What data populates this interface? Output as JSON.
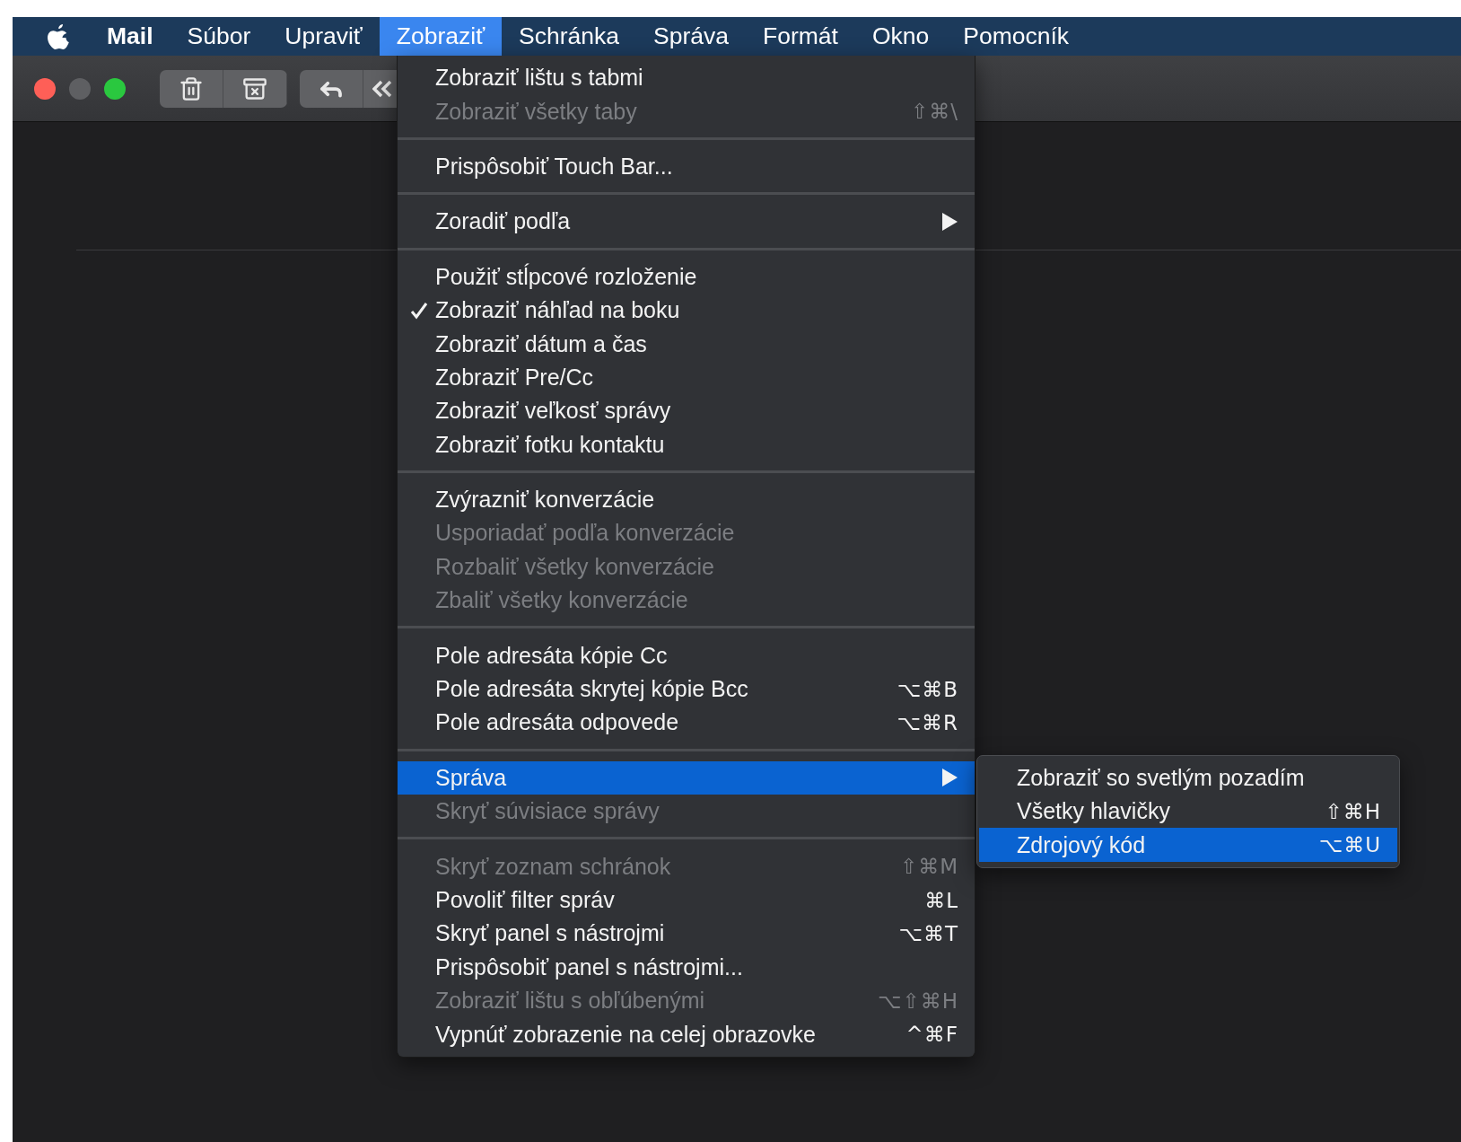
{
  "menu_bar": {
    "items": [
      {
        "label": "Mail",
        "kind": "app",
        "selected": false
      },
      {
        "label": "Súbor",
        "kind": "menu",
        "selected": false
      },
      {
        "label": "Upraviť",
        "kind": "menu",
        "selected": false
      },
      {
        "label": "Zobraziť",
        "kind": "menu",
        "selected": true
      },
      {
        "label": "Schránka",
        "kind": "menu",
        "selected": false
      },
      {
        "label": "Správa",
        "kind": "menu",
        "selected": false
      },
      {
        "label": "Formát",
        "kind": "menu",
        "selected": false
      },
      {
        "label": "Okno",
        "kind": "menu",
        "selected": false
      },
      {
        "label": "Pomocník",
        "kind": "menu",
        "selected": false
      }
    ]
  },
  "menu": {
    "sections": [
      {
        "items": [
          {
            "label": "Zobraziť lištu s tabmi",
            "checked": false,
            "disabled": false,
            "selected": false,
            "has_submenu": false
          },
          {
            "label": "Zobraziť všetky taby",
            "shortcut": "⇧⌘\\",
            "checked": false,
            "disabled": true,
            "selected": false,
            "has_submenu": false
          }
        ]
      },
      {
        "items": [
          {
            "label": "Prispôsobiť Touch Bar...",
            "checked": false,
            "disabled": false,
            "selected": false,
            "has_submenu": false
          }
        ]
      },
      {
        "items": [
          {
            "label": "Zoradiť podľa",
            "checked": false,
            "disabled": false,
            "selected": false,
            "has_submenu": true
          }
        ]
      },
      {
        "items": [
          {
            "label": "Použiť stĺpcové rozloženie",
            "checked": false,
            "disabled": false,
            "selected": false,
            "has_submenu": false
          },
          {
            "label": "Zobraziť náhľad na boku",
            "checked": true,
            "disabled": false,
            "selected": false,
            "has_submenu": false
          },
          {
            "label": "Zobraziť dátum a čas",
            "checked": false,
            "disabled": false,
            "selected": false,
            "has_submenu": false
          },
          {
            "label": "Zobraziť Pre/Cc",
            "checked": false,
            "disabled": false,
            "selected": false,
            "has_submenu": false
          },
          {
            "label": "Zobraziť veľkosť správy",
            "checked": false,
            "disabled": false,
            "selected": false,
            "has_submenu": false
          },
          {
            "label": "Zobraziť fotku kontaktu",
            "checked": false,
            "disabled": false,
            "selected": false,
            "has_submenu": false
          }
        ]
      },
      {
        "items": [
          {
            "label": "Zvýrazniť konverzácie",
            "checked": false,
            "disabled": false,
            "selected": false,
            "has_submenu": false
          },
          {
            "label": "Usporiadať podľa konverzácie",
            "checked": false,
            "disabled": true,
            "selected": false,
            "has_submenu": false
          },
          {
            "label": "Rozbaliť všetky konverzácie",
            "checked": false,
            "disabled": true,
            "selected": false,
            "has_submenu": false
          },
          {
            "label": "Zbaliť všetky konverzácie",
            "checked": false,
            "disabled": true,
            "selected": false,
            "has_submenu": false
          }
        ]
      },
      {
        "items": [
          {
            "label": "Pole adresáta kópie Cc",
            "checked": false,
            "disabled": false,
            "selected": false,
            "has_submenu": false
          },
          {
            "label": "Pole adresáta skrytej kópie Bcc",
            "shortcut": "⌥⌘B",
            "checked": false,
            "disabled": false,
            "selected": false,
            "has_submenu": false
          },
          {
            "label": "Pole adresáta odpovede",
            "shortcut": "⌥⌘R",
            "checked": false,
            "disabled": false,
            "selected": false,
            "has_submenu": false
          }
        ]
      },
      {
        "items": [
          {
            "label": "Správa",
            "checked": false,
            "disabled": false,
            "selected": true,
            "has_submenu": true,
            "submenu": {
              "items": [
                {
                  "label": "Zobraziť so svetlým pozadím",
                  "checked": false,
                  "disabled": false,
                  "selected": false
                },
                {
                  "label": "Všetky hlavičky",
                  "shortcut": "⇧⌘H",
                  "checked": false,
                  "disabled": false,
                  "selected": false
                },
                {
                  "label": "Zdrojový kód",
                  "shortcut": "⌥⌘U",
                  "checked": false,
                  "disabled": false,
                  "selected": true
                }
              ]
            }
          },
          {
            "label": "Skryť súvisiace správy",
            "checked": false,
            "disabled": true,
            "selected": false,
            "has_submenu": false
          }
        ]
      },
      {
        "items": [
          {
            "label": "Skryť zoznam schránok",
            "shortcut": "⇧⌘M",
            "checked": false,
            "disabled": true,
            "selected": false,
            "has_submenu": false
          },
          {
            "label": "Povoliť filter správ",
            "shortcut": "⌘L",
            "checked": false,
            "disabled": false,
            "selected": false,
            "has_submenu": false
          },
          {
            "label": "Skryť panel s nástrojmi",
            "shortcut": "⌥⌘T",
            "checked": false,
            "disabled": false,
            "selected": false,
            "has_submenu": false
          },
          {
            "label": "Prispôsobiť panel s nástrojmi...",
            "checked": false,
            "disabled": false,
            "selected": false,
            "has_submenu": false
          },
          {
            "label": "Zobraziť lištu s obľúbenými",
            "shortcut": "⌥⇧⌘H",
            "checked": false,
            "disabled": true,
            "selected": false,
            "has_submenu": false
          },
          {
            "label": "Vypnúť zobrazenie na celej obrazovke",
            "shortcut": "^⌘F",
            "checked": false,
            "disabled": false,
            "selected": false,
            "has_submenu": false
          }
        ]
      }
    ]
  }
}
